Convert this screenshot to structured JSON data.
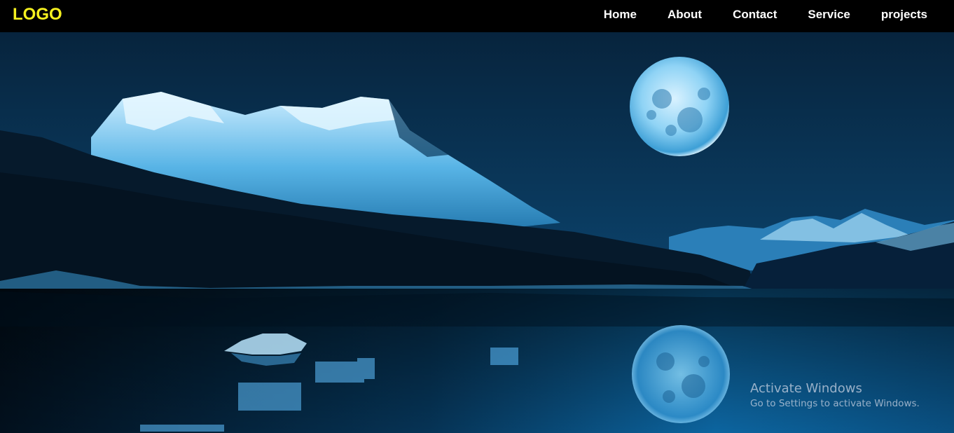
{
  "header": {
    "logo": "LOGO",
    "nav": [
      {
        "label": "Home"
      },
      {
        "label": "About"
      },
      {
        "label": "Contact"
      },
      {
        "label": "Service"
      },
      {
        "label": "projects"
      }
    ]
  },
  "colors": {
    "nav_background": "#000000",
    "logo": "#f5f01f",
    "nav_text": "#ffffff",
    "scene_tint": "#0a4a7a"
  },
  "overlay": {
    "title": "Activate Windows",
    "subtitle": "Go to Settings to activate Windows."
  }
}
